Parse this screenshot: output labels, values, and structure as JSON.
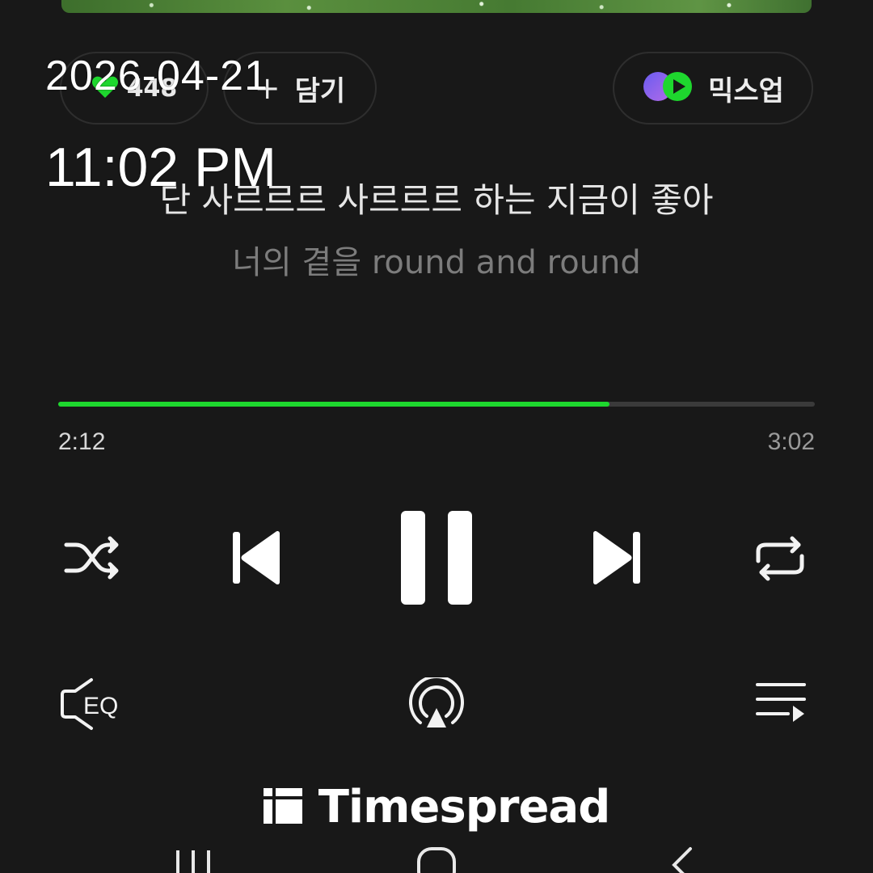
{
  "like": {
    "count": "448"
  },
  "add": {
    "label": "담기"
  },
  "mixup": {
    "label": "믹스업"
  },
  "overlay": {
    "date": "2026-04-21",
    "time": "11:02 PM"
  },
  "lyrics": {
    "current": "단 사르르르 사르르르 하는 지금이 좋아",
    "next": "너의 곁을 round and round"
  },
  "playback": {
    "elapsed": "2:12",
    "total": "3:02",
    "progress_fraction": 0.729,
    "state": "playing"
  },
  "controls": {
    "shuffle_icon": "shuffle-icon",
    "previous_icon": "skip-previous-icon",
    "pause_icon": "pause-icon",
    "next_icon": "skip-next-icon",
    "repeat_icon": "repeat-icon",
    "eq_icon": "equalizer-icon",
    "eq_label": "EQ",
    "airplay_icon": "cast-icon",
    "playlist_icon": "playlist-icon"
  },
  "watermark": {
    "text": "Timespread"
  },
  "colors": {
    "background": "#181818",
    "accent_green": "#1ed72e",
    "track": "#3a3a3a"
  }
}
